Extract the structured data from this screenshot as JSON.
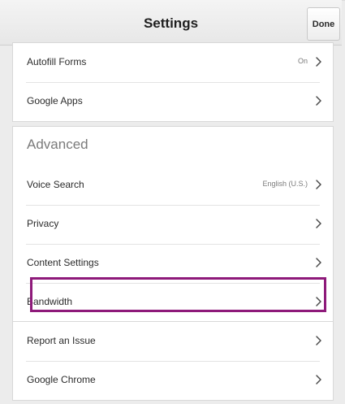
{
  "header": {
    "title": "Settings",
    "done_label": "Done"
  },
  "sections": [
    {
      "items": [
        {
          "label": "Autofill Forms",
          "value": "On"
        },
        {
          "label": "Google Apps",
          "value": ""
        }
      ]
    },
    {
      "title": "Advanced",
      "items": [
        {
          "label": "Voice Search",
          "value": "English (U.S.)"
        },
        {
          "label": "Privacy",
          "value": ""
        },
        {
          "label": "Content Settings",
          "value": ""
        },
        {
          "label": "Bandwidth",
          "value": ""
        }
      ]
    },
    {
      "items": [
        {
          "label": "Report an Issue",
          "value": ""
        },
        {
          "label": "Google Chrome",
          "value": ""
        }
      ]
    }
  ],
  "highlight": {
    "color": "#8e1a7a"
  },
  "icons": {
    "row_chevron": "chevron-right-icon"
  }
}
